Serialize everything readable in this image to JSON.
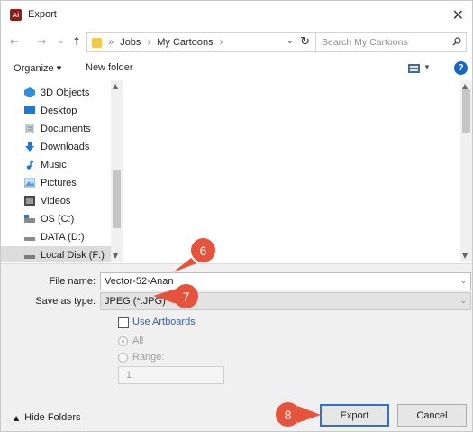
{
  "window": {
    "title": "Export",
    "app_icon_text": "Ai",
    "close_icon": "close-icon"
  },
  "nav": {
    "back_icon": "arrow-left-icon",
    "forward_icon": "arrow-right-icon",
    "recent_icon": "chevron-down-icon",
    "up_icon": "arrow-up-icon",
    "breadcrumbs": [
      "Jobs",
      "My Cartoons"
    ],
    "search_placeholder": "Search My Cartoons"
  },
  "toolbar": {
    "organize_label": "Organize ▾",
    "new_folder_label": "New folder",
    "help_label": "?"
  },
  "sidebar": {
    "items": [
      {
        "label": "3D Objects",
        "icon": "3d-objects-icon",
        "color": "#2f8fd8"
      },
      {
        "label": "Desktop",
        "icon": "desktop-icon",
        "color": "#1f78d1"
      },
      {
        "label": "Documents",
        "icon": "documents-icon",
        "color": "#9aa6b2"
      },
      {
        "label": "Downloads",
        "icon": "downloads-icon",
        "color": "#1f78d1"
      },
      {
        "label": "Music",
        "icon": "music-icon",
        "color": "#1f78d1"
      },
      {
        "label": "Pictures",
        "icon": "pictures-icon",
        "color": "#5aa0e0"
      },
      {
        "label": "Videos",
        "icon": "videos-icon",
        "color": "#4a4a4a"
      },
      {
        "label": "OS (C:)",
        "icon": "drive-icon",
        "color": "#6c7a89"
      },
      {
        "label": "DATA (D:)",
        "icon": "drive-icon",
        "color": "#8a8a8a"
      },
      {
        "label": "Local Disk (F:)",
        "icon": "drive-icon",
        "color": "#8a8a8a",
        "selected": true
      }
    ]
  },
  "form": {
    "file_name_label": "File name:",
    "file_name_value": "Vector-52-Anan",
    "save_type_label": "Save as type:",
    "save_type_value": "JPEG (*.JPG)",
    "use_artboards_label": "Use Artboards",
    "all_label": "All",
    "range_label": "Range:",
    "range_value": "1"
  },
  "footer": {
    "hide_folders_label": "Hide Folders",
    "export_label": "Export",
    "cancel_label": "Cancel"
  },
  "callouts": {
    "step6": "6",
    "step7": "7",
    "step8": "8",
    "color": "#e5533d"
  }
}
